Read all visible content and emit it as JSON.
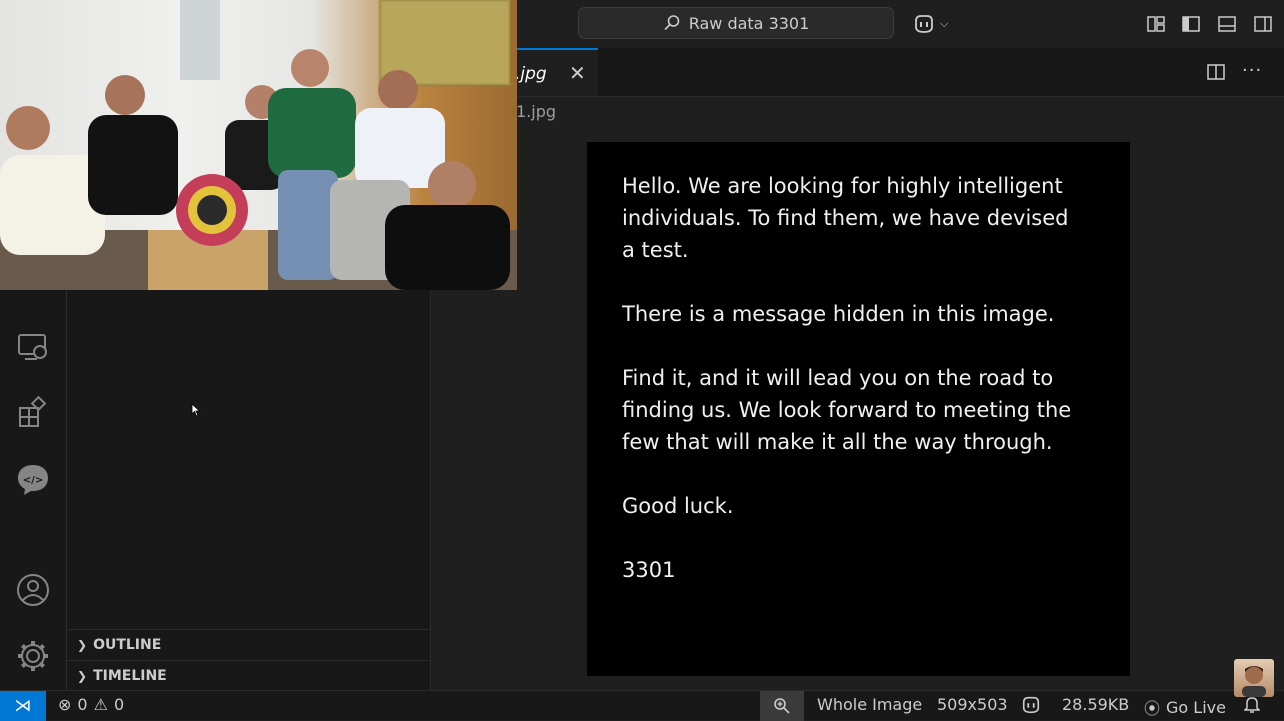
{
  "titlebar": {
    "search_text": "Raw data 3301",
    "search_icon": "search-icon",
    "copilot_icon": "copilot-icon"
  },
  "tab": {
    "label": ".jpg",
    "close_glyph": "✕"
  },
  "breadcrumb": "1.jpg",
  "image_message": {
    "p1": "Hello.  We are looking for highly intelligent\nindividuals.  To find them, we have devised\na test.",
    "p2": "There is a message hidden in this image.",
    "p3": "Find it, and it will lead you on the road to\nfinding us.  We look forward to meeting the\nfew that will make it all the way through.",
    "p4": "Good luck.",
    "p5": "3301"
  },
  "sidebar": {
    "outline_label": "OUTLINE",
    "timeline_label": "TIMELINE"
  },
  "statusbar": {
    "errors": "0",
    "warnings": "0",
    "zoom_mode": "Whole Image",
    "dimensions": "509x503",
    "file_size": "28.59KB",
    "go_live": "Go Live"
  },
  "colors": {
    "accent": "#0078d4",
    "editor_bg": "#1f1f1f",
    "panel_bg": "#181818",
    "image_bg": "#000000"
  }
}
